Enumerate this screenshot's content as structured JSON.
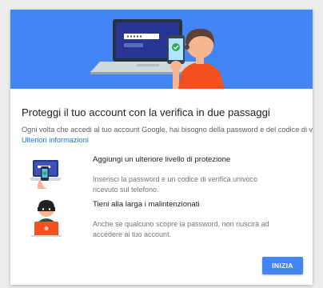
{
  "dialog": {
    "title": "Proteggi il tuo account con la verifica in due passaggi",
    "intro_text": "Ogni volta che accedi al tuo account Google, hai bisogno della password e del codice di verifica.",
    "learn_more_link": "Ulteriori informazioni",
    "features": [
      {
        "icon": "laptop-phone-icon",
        "heading": "Aggiungi un ulteriore livello di protezione",
        "description": "Inserisci la password e un codice di verifica univoco ricevuto sul telefono."
      },
      {
        "icon": "burglar-laptop-icon",
        "heading": "Tieni alla larga i malintenzionati",
        "description": "Anche se qualcuno scopre la password, non riuscirà ad accedere al tuo account."
      }
    ],
    "start_button": "INIZIA"
  },
  "colors": {
    "accent": "#4285f4",
    "link": "#1a73e8",
    "background": "#ececec"
  }
}
